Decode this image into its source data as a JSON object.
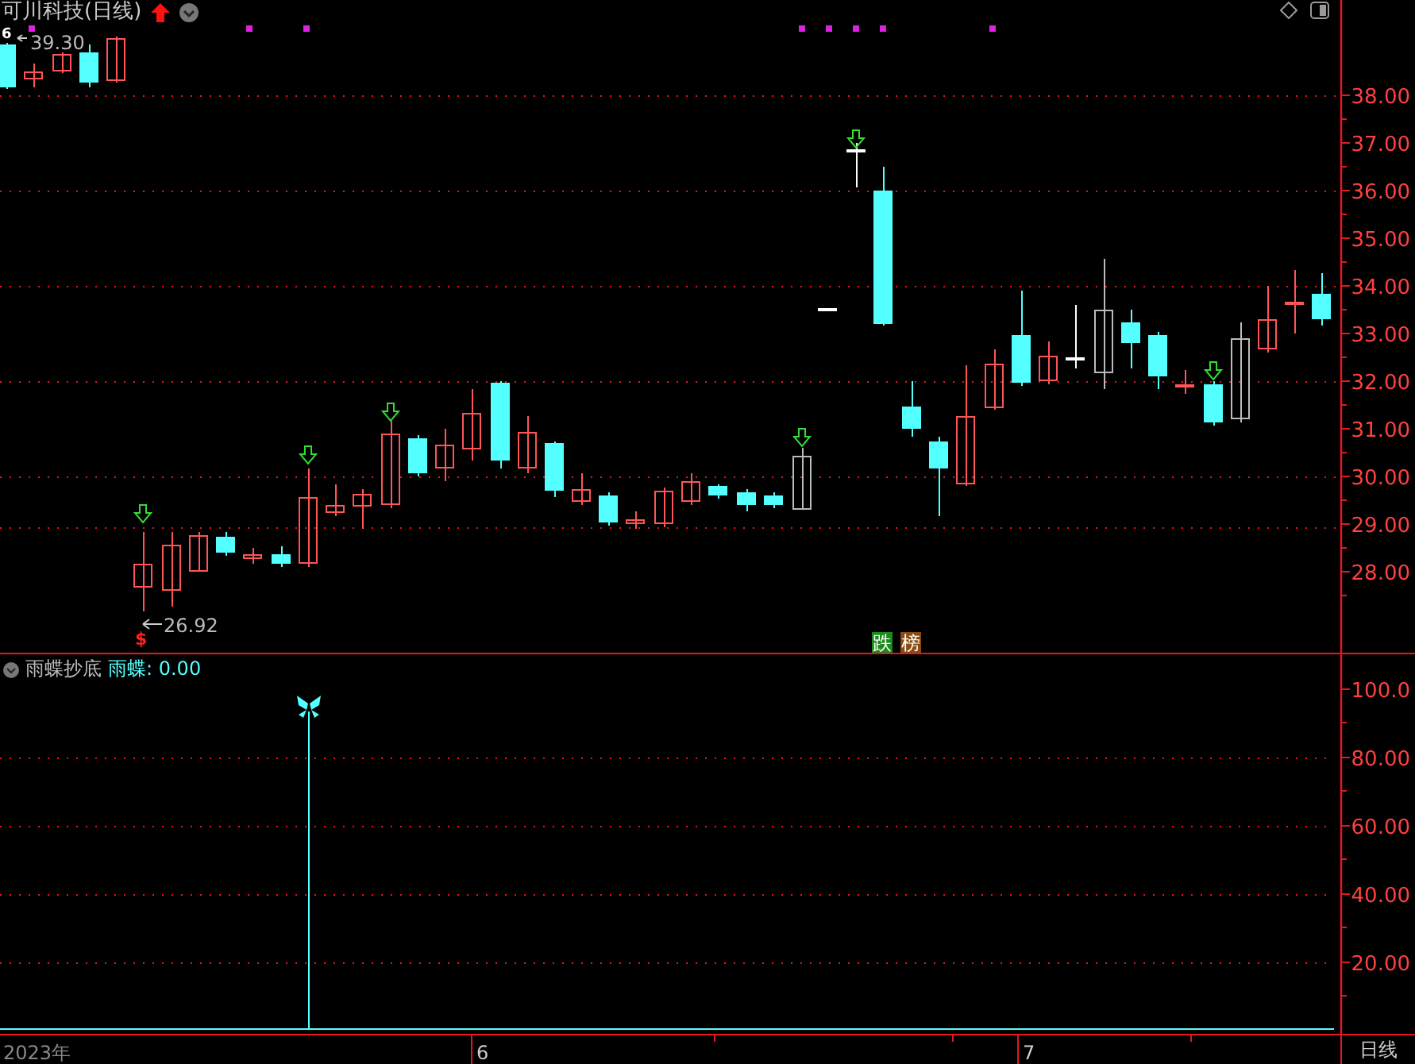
{
  "header": {
    "title": "可川科技(日线)"
  },
  "price_chart": {
    "high_marker": "6",
    "high_label": "39.30",
    "low_label": "26.92",
    "signal_mark": "$",
    "tags": [
      {
        "label": "跌",
        "color": "#1a8a1a"
      },
      {
        "label": "榜",
        "color": "#8a4a10"
      }
    ],
    "yticks": [
      "38.00",
      "37.00",
      "36.00",
      "35.00",
      "34.00",
      "33.00",
      "32.00",
      "31.00",
      "30.00",
      "29.00",
      "28.00"
    ]
  },
  "indicator": {
    "name": "雨蝶抄底",
    "reading": "雨蝶: 0.00",
    "yticks": [
      "100.0",
      "80.00",
      "60.00",
      "40.00",
      "20.00"
    ]
  },
  "time_axis": {
    "labels": [
      "2023年",
      "6",
      "7"
    ],
    "period": "日线"
  }
}
